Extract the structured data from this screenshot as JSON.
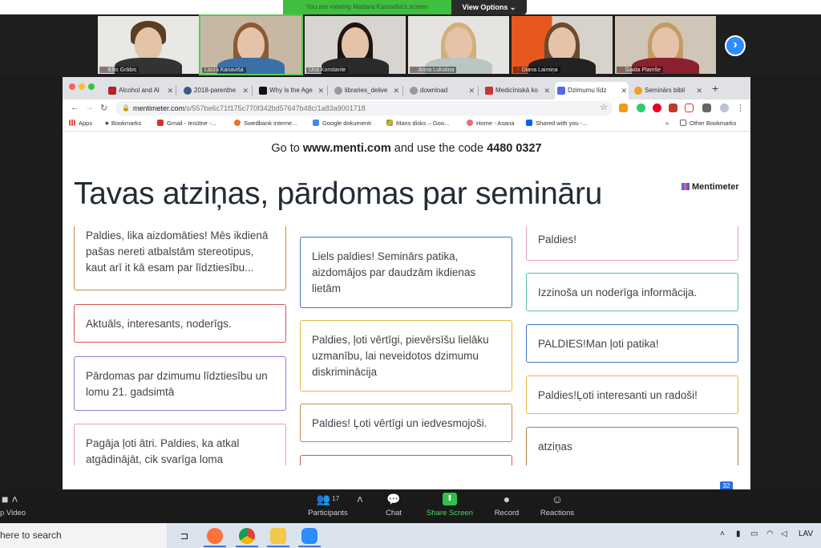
{
  "zoom": {
    "viewing_banner": "You are viewing Madara Kanaviša's screen",
    "view_options_label": "View Options",
    "participants": [
      {
        "name": "Ellis Grābis"
      },
      {
        "name": "Laura Kanaviša"
      },
      {
        "name": "Una Konstante"
      },
      {
        "name": "Anna Lukstiņa"
      },
      {
        "name": "Diana Laimiņa"
      },
      {
        "name": "Gaida Plamše"
      }
    ],
    "toolbar": {
      "video_label": "p Video",
      "participants_label": "Participants",
      "participants_count": "17",
      "chat_label": "Chat",
      "share_label": "Share Screen",
      "record_label": "Record",
      "reactions_label": "Reactions"
    }
  },
  "browser": {
    "tabs": [
      {
        "label": "Alcohol and Al"
      },
      {
        "label": "2018-parenthe"
      },
      {
        "label": "Why Is the Age"
      },
      {
        "label": "libraries_delive"
      },
      {
        "label": "download"
      },
      {
        "label": "Medicīniskā ko"
      },
      {
        "label": "Dzimumu līdz"
      },
      {
        "label": "Seminārs bibli"
      }
    ],
    "url_host": "mentimeter.com",
    "url_path": "/s/557be6c71f175c770f342bd57647b48c/1a83a9001718",
    "bookmarks": [
      {
        "label": "Apps"
      },
      {
        "label": "Bookmarks"
      },
      {
        "label": "Gmail - Iesūtne -..."
      },
      {
        "label": "Swedbank interne..."
      },
      {
        "label": "Google dokumenti"
      },
      {
        "label": "Mans disks – Goo..."
      },
      {
        "label": "Home - Asana"
      },
      {
        "label": "Shared with you -..."
      },
      {
        "label": "Other Bookmarks"
      }
    ],
    "more_bookmarks": "»"
  },
  "slide": {
    "join_prefix": "Go to",
    "join_site": "www.menti.com",
    "join_mid": "and use the code",
    "join_code": "4480 0327",
    "title": "Tavas atziņas, pārdomas par semināru",
    "logo": "Mentimeter",
    "page_badge": "32",
    "responses": [
      {
        "text": "Paldies, lika aizdomāties! Mēs ikdienā pašas nereti atbalstām stereotipus, kaut arī it kā esam par līdztiesību...",
        "color": "#c98a4a"
      },
      {
        "text": "Aktuāls, interesants, noderīgs.",
        "color": "#d9534f"
      },
      {
        "text": "Pārdomas par dzimumu līdztiesību un lomu 21. gadsimtā",
        "color": "#9d7ad0"
      },
      {
        "text": "Pagāja ļoti ātri. Paldies, ka atkal atgādinājāt, cik svarīga loma",
        "color": "#e89ac6"
      },
      {
        "text": "Liels paldies! Seminārs patika, aizdomājos par daudzām ikdienas lietām",
        "color": "#3f74c6"
      },
      {
        "text": "Paldies, ļoti vērtīgi, pievērsīšu lielāku uzmanību, lai neveidotos dzimumu diskriminācija",
        "color": "#e3b93c"
      },
      {
        "text": "Paldies! Ļoti vērtīgi un iedvesmojoši.",
        "color": "#c98a4a"
      },
      {
        "text": "",
        "color": "#d9534f"
      },
      {
        "text": "Paldies!",
        "color": "#e89ac6"
      },
      {
        "text": "Izzinoša un noderīga informācija.",
        "color": "#5bc0a6"
      },
      {
        "text": "PALDIES!Man ļoti patika!",
        "color": "#3f74c6"
      },
      {
        "text": "Paldies!Ļoti interesanti un radoši!",
        "color": "#e3b93c"
      },
      {
        "text": "atziņas",
        "color": "#b07a3e"
      }
    ]
  },
  "taskbar": {
    "search_text": "here to search",
    "language": "LAV"
  }
}
